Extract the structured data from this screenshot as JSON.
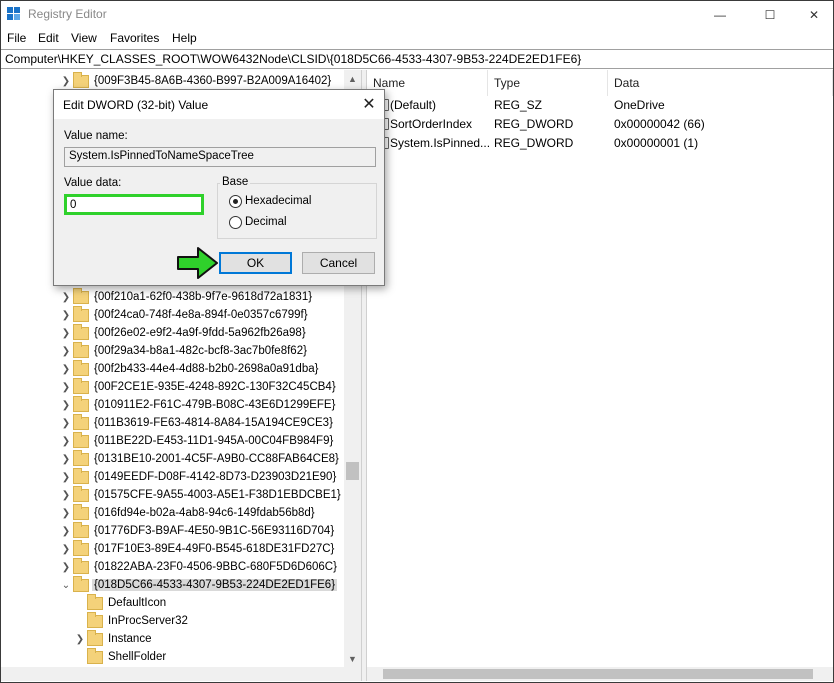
{
  "window": {
    "title": "Registry Editor",
    "controls": {
      "minimize": "—",
      "maximize": "☐",
      "close": "✕"
    }
  },
  "menu": [
    "File",
    "Edit",
    "View",
    "Favorites",
    "Help"
  ],
  "address": "Computer\\HKEY_CLASSES_ROOT\\WOW6432Node\\CLSID\\{018D5C66-4533-4307-9B53-224DE2ED1FE6}",
  "tree": {
    "top_item": "{009F3B45-8A6B-4360-B997-B2A009A16402}",
    "items": [
      "{00f210a1-62f0-438b-9f7e-9618d72a1831}",
      "{00f24ca0-748f-4e8a-894f-0e0357c6799f}",
      "{00f26e02-e9f2-4a9f-9fdd-5a962fb26a98}",
      "{00f29a34-b8a1-482c-bcf8-3ac7b0fe8f62}",
      "{00f2b433-44e4-4d88-b2b0-2698a0a91dba}",
      "{00F2CE1E-935E-4248-892C-130F32C45CB4}",
      "{010911E2-F61C-479B-B08C-43E6D1299EFE}",
      "{011B3619-FE63-4814-8A84-15A194CE9CE3}",
      "{011BE22D-E453-11D1-945A-00C04FB984F9}",
      "{0131BE10-2001-4C5F-A9B0-CC88FAB64CE8}",
      "{0149EEDF-D08F-4142-8D73-D23903D21E90}",
      "{01575CFE-9A55-4003-A5E1-F38D1EBDCBE1}",
      "{016fd94e-b02a-4ab8-94c6-149fdab56b8d}",
      "{01776DF3-B9AF-4E50-9B1C-56E93116D704}",
      "{017F10E3-89E4-49F0-B545-618DE31FD27C}",
      "{01822ABA-23F0-4506-9BBC-680F5D6D606C}"
    ],
    "selected": "{018D5C66-4533-4307-9B53-224DE2ED1FE6}",
    "children": [
      "DefaultIcon",
      "InProcServer32",
      "Instance",
      "ShellFolder"
    ]
  },
  "values": {
    "columns": [
      "Name",
      "Type",
      "Data"
    ],
    "rows": [
      {
        "name": "(Default)",
        "type": "REG_SZ",
        "data": "OneDrive"
      },
      {
        "name": "SortOrderIndex",
        "type": "REG_DWORD",
        "data": "0x00000042 (66)"
      },
      {
        "name": "System.IsPinned...",
        "type": "REG_DWORD",
        "data": "0x00000001 (1)"
      }
    ]
  },
  "dialog": {
    "title": "Edit DWORD (32-bit) Value",
    "value_name_label": "Value name:",
    "value_name": "System.IsPinnedToNameSpaceTree",
    "value_data_label": "Value data:",
    "value_data": "0",
    "base_label": "Base",
    "radio_hex": "Hexadecimal",
    "radio_dec": "Decimal",
    "selected_base": "Hexadecimal",
    "ok": "OK",
    "cancel": "Cancel"
  },
  "colors": {
    "highlight_green": "#2fd12b",
    "accent": "#0078d7",
    "folder": "#f4d27a"
  }
}
